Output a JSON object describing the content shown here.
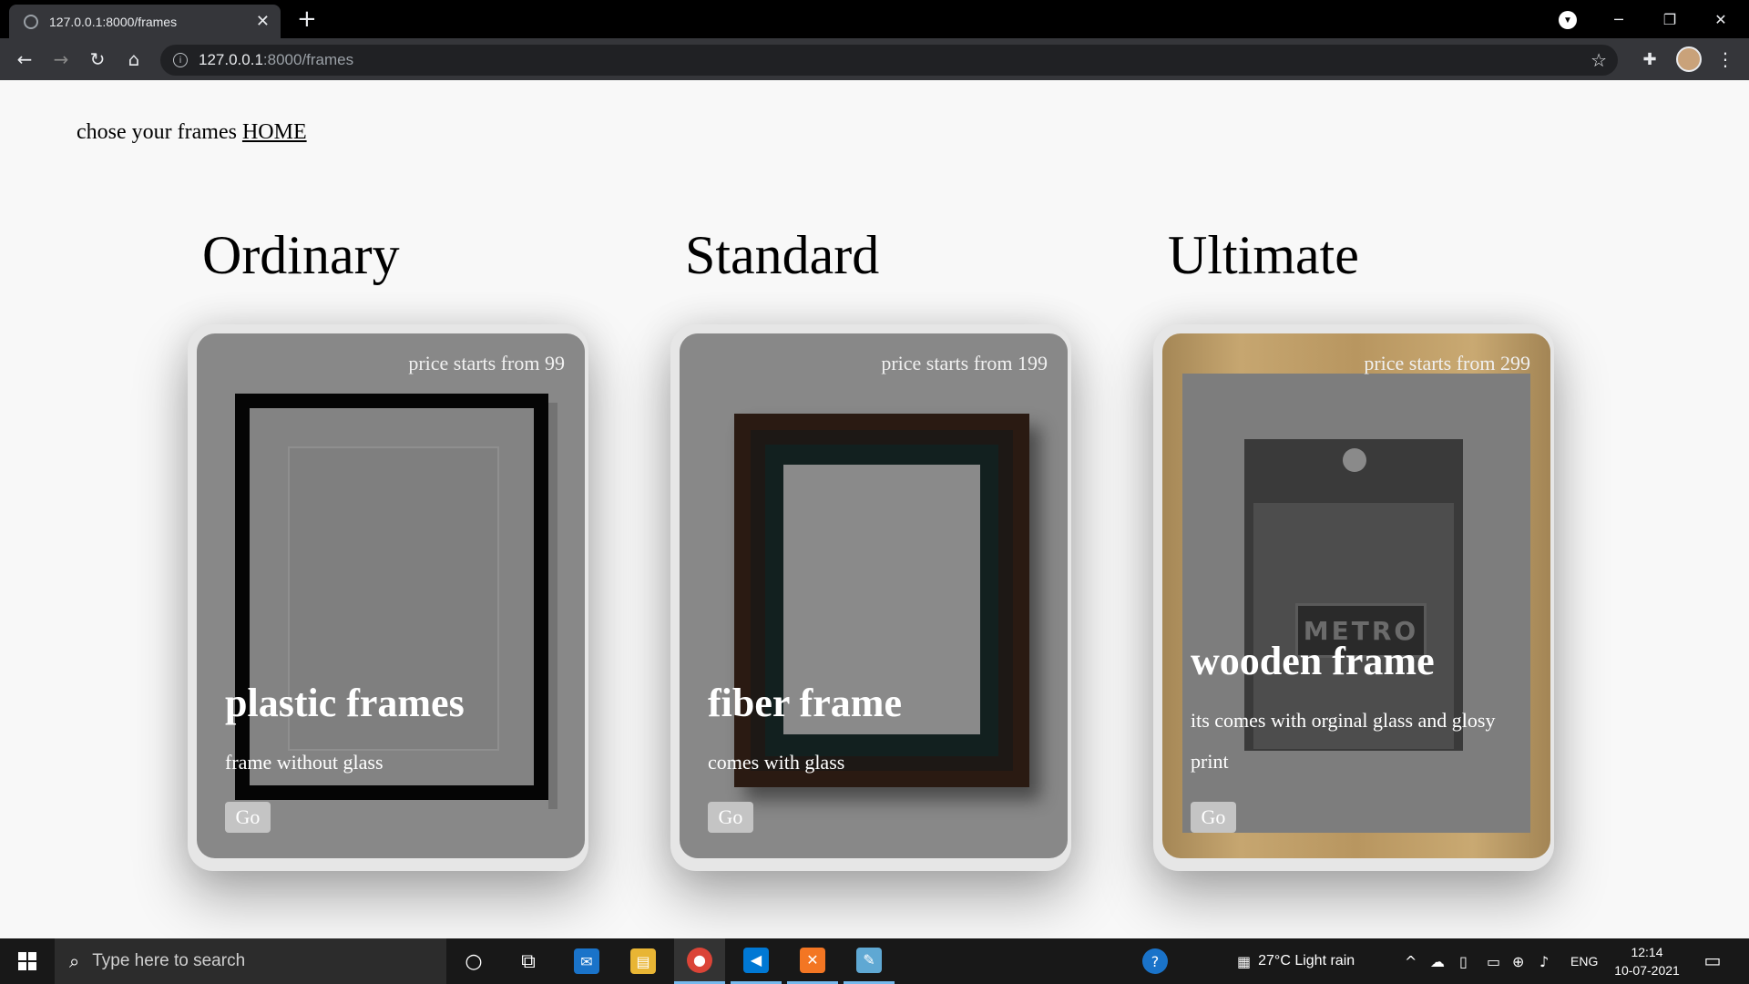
{
  "browser": {
    "tab_title": "127.0.0.1:8000/frames",
    "tab_close": "✕",
    "new_tab": "+",
    "url_host": "127.0.0.1",
    "url_path": ":8000/frames",
    "icons": [
      "back-arrow-icon",
      "forward-arrow-icon",
      "reload-icon",
      "home-icon",
      "info-icon",
      "star-icon",
      "extensions-icon",
      "avatar",
      "menu-icon"
    ]
  },
  "header": {
    "text": "chose your frames",
    "home_link": "HOME"
  },
  "columns": [
    {
      "heading": "Ordinary",
      "price": "price starts from 99",
      "title": "plastic frames",
      "desc": "frame without glass",
      "button": "Go"
    },
    {
      "heading": "Standard",
      "price": "price starts from 199",
      "title": "fiber frame",
      "desc": "comes with glass",
      "button": "Go"
    },
    {
      "heading": "Ultimate",
      "price": "price starts from 299",
      "title": "wooden frame",
      "desc": "its comes with orginal glass and glosy print",
      "button": "Go",
      "photo_sign": "METRO"
    }
  ],
  "taskbar": {
    "search_placeholder": "Type here to search",
    "weather": "27°C  Light rain",
    "lang": "ENG",
    "time": "12:14",
    "date": "10-07-2021"
  },
  "colors": {
    "page_bg": "#f8f8f8",
    "card_overlay": "#888888",
    "button_bg": "#c4c4c4",
    "chrome_dark": "#35363a",
    "taskbar": "#181818",
    "accent_blue": "#76b9ed"
  }
}
